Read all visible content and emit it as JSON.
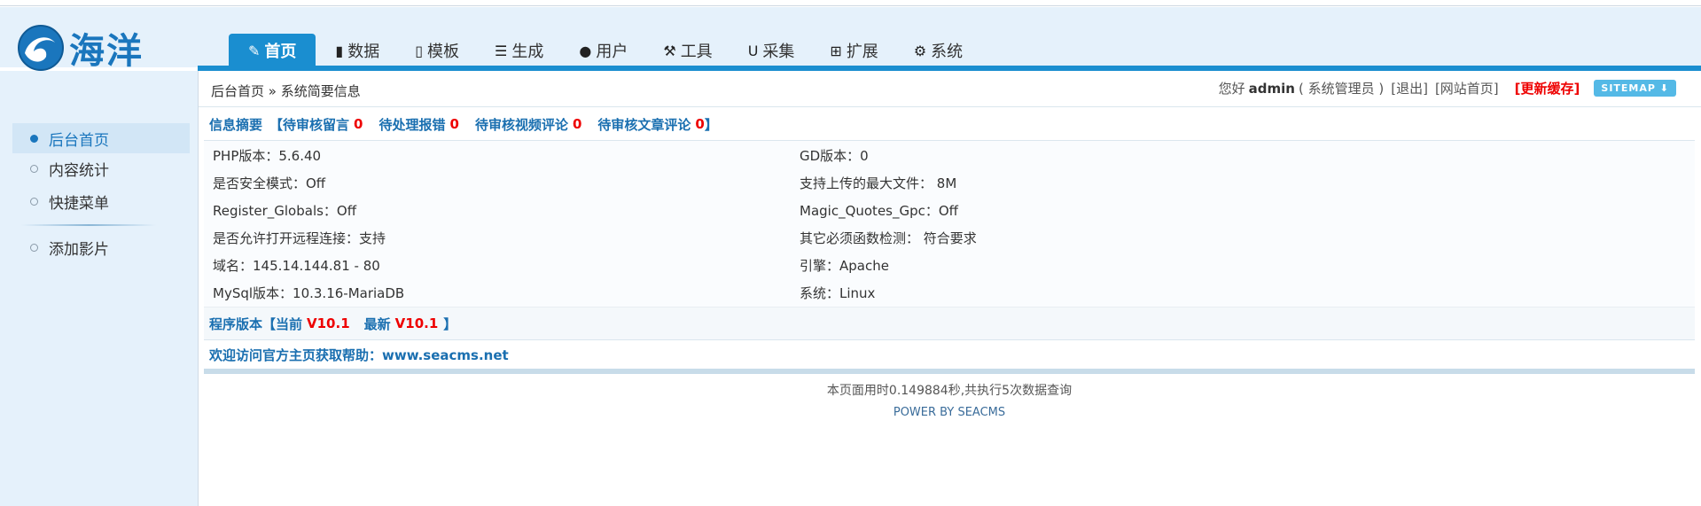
{
  "app": {
    "logo_text": "海洋"
  },
  "nav": {
    "items": [
      {
        "label": "首页",
        "icon": "edit-icon",
        "glyph": "✎",
        "active": true
      },
      {
        "label": "数据",
        "icon": "book-icon",
        "glyph": "▮"
      },
      {
        "label": "模板",
        "icon": "file-icon",
        "glyph": "▯"
      },
      {
        "label": "生成",
        "icon": "server-icon",
        "glyph": "☰"
      },
      {
        "label": "用户",
        "icon": "user-icon",
        "glyph": "●"
      },
      {
        "label": "工具",
        "icon": "wrench-icon",
        "glyph": "⚒"
      },
      {
        "label": "采集",
        "icon": "magnet-icon",
        "glyph": "U"
      },
      {
        "label": "扩展",
        "icon": "sitemap-icon",
        "glyph": "⊞"
      },
      {
        "label": "系统",
        "icon": "gear-icon",
        "glyph": "⚙"
      }
    ]
  },
  "breadcrumb": "后台首页 » 系统简要信息",
  "user": {
    "greeting": "您好",
    "name": "admin",
    "role": "( 系统管理员 )",
    "logout": "[退出]",
    "site_home": "[网站首页]",
    "refresh_cache": "[更新缓存]",
    "sitemap": "SITEMAP ⬇"
  },
  "sidebar": {
    "items": [
      {
        "label": "后台首页",
        "active": true
      },
      {
        "label": "内容统计"
      },
      {
        "label": "快捷菜单"
      },
      {
        "label": "添加影片"
      }
    ]
  },
  "summary": {
    "title": "信息摘要",
    "open": "【",
    "items": [
      {
        "label": "待审核留言",
        "count": "0"
      },
      {
        "label": "待处理报错",
        "count": "0"
      },
      {
        "label": "待审核视频评论",
        "count": "0"
      },
      {
        "label": "待审核文章评论",
        "count": "0"
      }
    ],
    "close": "】"
  },
  "info": {
    "rows": [
      [
        "PHP版本：5.6.40",
        "GD版本：0"
      ],
      [
        "是否安全模式：Off",
        "支持上传的最大文件： 8M"
      ],
      [
        "Register_Globals：Off",
        "Magic_Quotes_Gpc：Off"
      ],
      [
        "是否允许打开远程连接：支持",
        "其它必须函数检测： 符合要求"
      ],
      [
        "域名：145.14.144.81 - 80",
        "引擎：Apache"
      ],
      [
        "MySql版本：10.3.16-MariaDB",
        "系统：Linux"
      ]
    ]
  },
  "version": {
    "label": "程序版本【当前",
    "current": "V10.1",
    "latest_label": "最新",
    "latest": "V10.1",
    "close": "】"
  },
  "welcome": "欢迎访问官方主页获取帮助：www.seacms.net",
  "footer": {
    "timing": "本页面用时0.149884秒,共执行5次数据查询",
    "power": "POWER BY SEACMS"
  },
  "colors": {
    "accent": "#1a8ed0",
    "link": "#1a6fb0",
    "alert": "#e00000",
    "panel_bg": "#e5f1fb"
  }
}
